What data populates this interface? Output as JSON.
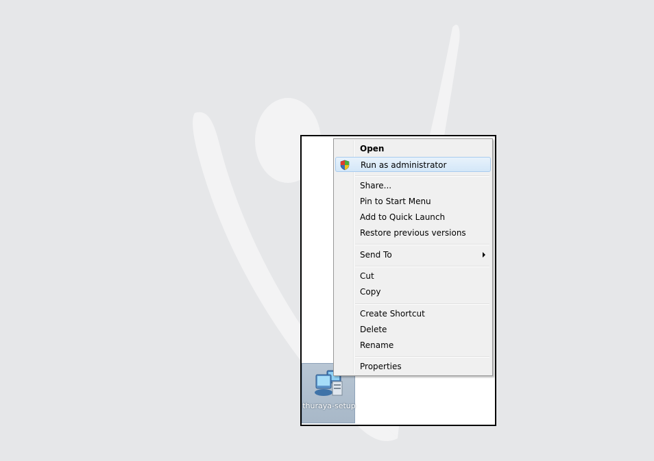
{
  "background": {
    "color": "#e6e7e9",
    "watermark_color": "#f3f3f4"
  },
  "desktop_icon": {
    "icon": "setup-program-icon",
    "label": "thuraya-setup"
  },
  "context_menu": {
    "items": [
      {
        "label": "Open",
        "bold": true
      },
      {
        "label": "Run as administrator",
        "icon": "uac-shield-icon",
        "highlighted": true
      },
      {
        "label": "Share..."
      },
      {
        "label": "Pin to Start Menu"
      },
      {
        "label": "Add to Quick Launch"
      },
      {
        "label": "Restore previous versions"
      },
      {
        "label": "Send To",
        "submenu": true
      },
      {
        "label": "Cut"
      },
      {
        "label": "Copy"
      },
      {
        "label": "Create Shortcut"
      },
      {
        "label": "Delete"
      },
      {
        "label": "Rename"
      },
      {
        "label": "Properties"
      }
    ]
  },
  "colors": {
    "highlight_border": "#a8cbee",
    "menu_background": "#f0f0f0"
  }
}
